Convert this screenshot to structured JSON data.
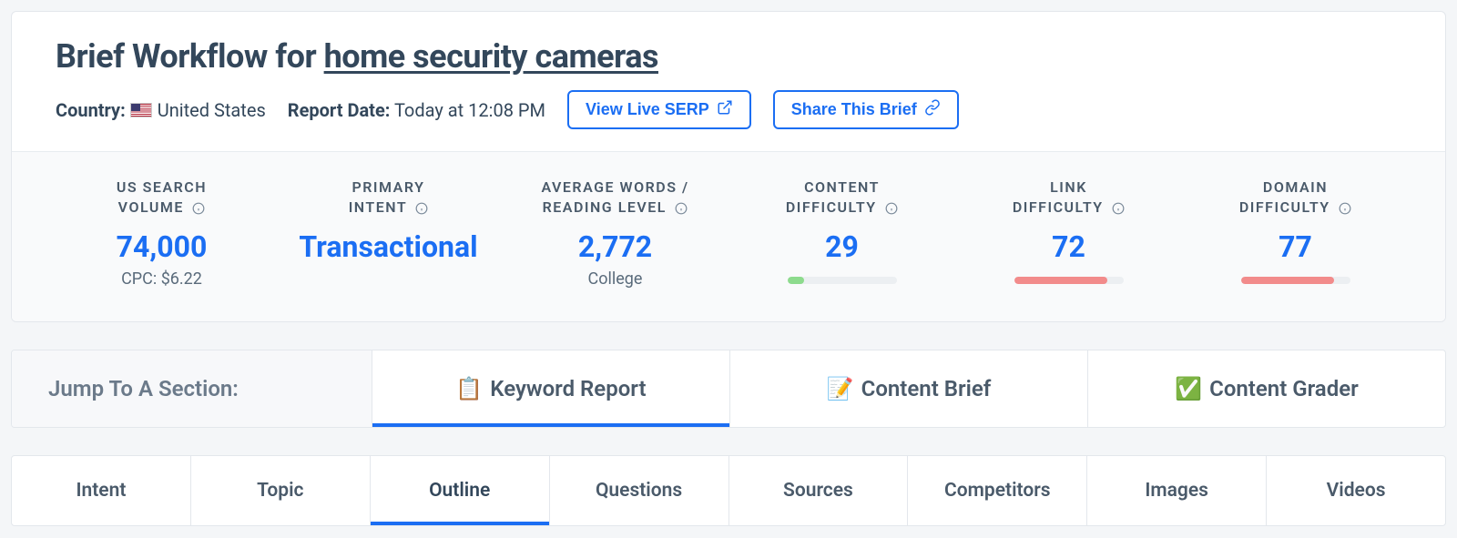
{
  "header": {
    "title_prefix": "Brief Workflow for ",
    "keyword": "home security cameras",
    "country_label": "Country:",
    "country_value": "United States",
    "report_date_label": "Report Date:",
    "report_date_value": "Today at 12:08 PM",
    "view_serp_label": "View Live SERP",
    "share_label": "Share This Brief"
  },
  "stats": {
    "search_volume": {
      "label_line1": "US SEARCH",
      "label_line2": "VOLUME",
      "value": "74,000",
      "sub": "CPC: $6.22"
    },
    "primary_intent": {
      "label_line1": "PRIMARY",
      "label_line2": "INTENT",
      "value": "Transactional"
    },
    "avg_words": {
      "label_line1": "AVERAGE WORDS /",
      "label_line2": "READING LEVEL",
      "value": "2,772",
      "sub": "College"
    },
    "content_difficulty": {
      "label_line1": "CONTENT",
      "label_line2": "DIFFICULTY",
      "value": "29",
      "bar_pct": 15,
      "bar_color": "green"
    },
    "link_difficulty": {
      "label_line1": "LINK",
      "label_line2": "DIFFICULTY",
      "value": "72",
      "bar_pct": 85,
      "bar_color": "red"
    },
    "domain_difficulty": {
      "label_line1": "DOMAIN",
      "label_line2": "DIFFICULTY",
      "value": "77",
      "bar_pct": 85,
      "bar_color": "red"
    }
  },
  "section_tabs": {
    "lead": "Jump To A Section:",
    "tabs": [
      {
        "emoji": "📋",
        "label": "Keyword Report",
        "active": true
      },
      {
        "emoji": "📝",
        "label": "Content Brief",
        "active": false
      },
      {
        "emoji": "✅",
        "label": "Content Grader",
        "active": false
      }
    ]
  },
  "sub_tabs": [
    {
      "label": "Intent",
      "active": false
    },
    {
      "label": "Topic",
      "active": false
    },
    {
      "label": "Outline",
      "active": true
    },
    {
      "label": "Questions",
      "active": false
    },
    {
      "label": "Sources",
      "active": false
    },
    {
      "label": "Competitors",
      "active": false
    },
    {
      "label": "Images",
      "active": false
    },
    {
      "label": "Videos",
      "active": false
    }
  ]
}
